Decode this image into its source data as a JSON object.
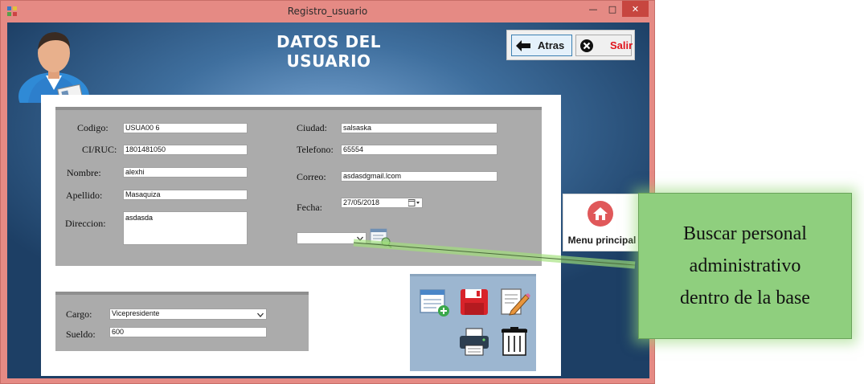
{
  "window": {
    "title": "Registro_usuario",
    "min_glyph": "—",
    "max_glyph": "□",
    "close_glyph": "✕"
  },
  "header": {
    "form_title": "DATOS DEL USUARIO"
  },
  "top_buttons": {
    "back_label": "Atras",
    "exit_label": "Salir"
  },
  "labels": {
    "codigo": "Codigo:",
    "ciruc": "CI/RUC:",
    "nombre": "Nombre:",
    "apellido": "Apellido:",
    "direccion": "Direccion:",
    "ciudad": "Ciudad:",
    "telefono": "Telefono:",
    "correo": "Correo:",
    "fecha": "Fecha:",
    "cargo": "Cargo:",
    "sueldo": "Sueldo:"
  },
  "values": {
    "codigo": "USUA00 6",
    "ciruc": "1801481050",
    "nombre": "alexhi",
    "apellido": "Masaquiza",
    "direccion": "asdasda",
    "ciudad": "salsaska",
    "telefono": "65554",
    "correo": "asdasdgmail.lcom",
    "fecha": "27/05/2018",
    "search_combo": "",
    "cargo": "Vicepresidente",
    "sueldo": "600"
  },
  "menu": {
    "label": "Menu principal"
  },
  "callout": {
    "lines": [
      "Buscar personal",
      "administrativo",
      "dentro de la base"
    ]
  },
  "colors": {
    "exit_red": "#e0141c",
    "callout_green": "#8fcf7e",
    "panel_grey": "#ababab",
    "tool_panel": "#9cb6d0"
  },
  "icons": {
    "back": "arrow-left-icon",
    "exit": "close-circle-icon",
    "menu": "home-icon",
    "search": "search-record-icon",
    "new": "new-record-icon",
    "save": "save-icon",
    "edit": "edit-icon",
    "print": "printer-icon",
    "delete": "trash-icon",
    "calendar": "calendar-icon"
  }
}
